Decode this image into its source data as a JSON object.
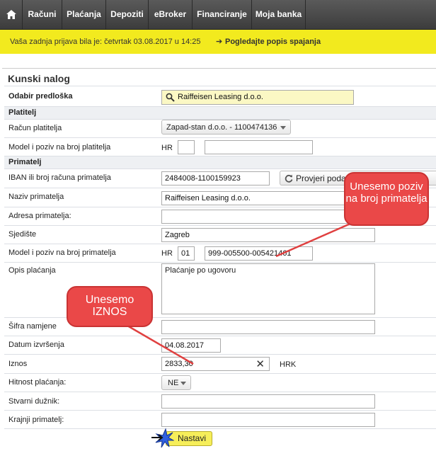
{
  "nav": {
    "home_icon": "home-icon",
    "items": [
      "Računi",
      "Plaćanja",
      "Depoziti",
      "eBroker",
      "Financiranje",
      "Moja banka"
    ]
  },
  "info": {
    "last_login": "Vaša zadnja prijava bila je: četvrtak 03.08.2017 u 14:25",
    "link": "Pogledajte popis spajanja"
  },
  "form": {
    "title": "Kunski nalog",
    "template_label": "Odabir predloška",
    "template_value": "Raiffeisen Leasing d.o.o.",
    "payer_section": "Platitelj",
    "payer_account_label": "Račun platitelja",
    "payer_account_value": "Zapad-stan d.o.o. - 1100474136",
    "payer_model_label": "Model i poziv na broj platitelja",
    "payer_model_prefix": "HR",
    "payer_model_value": "",
    "payer_ref_value": "",
    "recipient_section": "Primatelj",
    "iban_label": "IBAN ili broj računa primatelja",
    "iban_value": "2484008-1100159923",
    "verify_button": "Provjeri poda",
    "name_label": "Naziv primatelja",
    "name_value": "Raiffeisen Leasing d.o.o.",
    "address_label": "Adresa primatelja:",
    "address_value": "",
    "seat_label": "Sjedište",
    "seat_value": "Zagreb",
    "rec_model_label": "Model i poziv na broj primatelja",
    "rec_model_prefix": "HR",
    "rec_model_value": "01",
    "rec_ref_value": "999-005500-005421461",
    "desc_label": "Opis plaćanja",
    "desc_value": "Plaćanje po ugovoru",
    "purpose_label": "Šifra namjene",
    "purpose_value": "",
    "exec_date_label": "Datum izvršenja",
    "exec_date_value": "04.08.2017",
    "amount_label": "Iznos",
    "amount_value": "2833,30",
    "currency": "HRK",
    "urgency_label": "Hitnost plaćanja:",
    "urgency_value": "NE",
    "debtor_label": "Stvarni dužnik:",
    "debtor_value": "",
    "final_label": "Krajnji primatelj:",
    "final_value": "",
    "continue_button": "Nastavi"
  },
  "callouts": {
    "ref": "Unesemo poziv na broj primatelja",
    "amount": "Unesemo IZNOS"
  },
  "colors": {
    "nav_bg": "#4a4a4a",
    "info_bar": "#f2ea1e",
    "callout": "#ea4848",
    "highlight_field": "#fbf8c4",
    "continue_button": "#f6ee5a"
  }
}
